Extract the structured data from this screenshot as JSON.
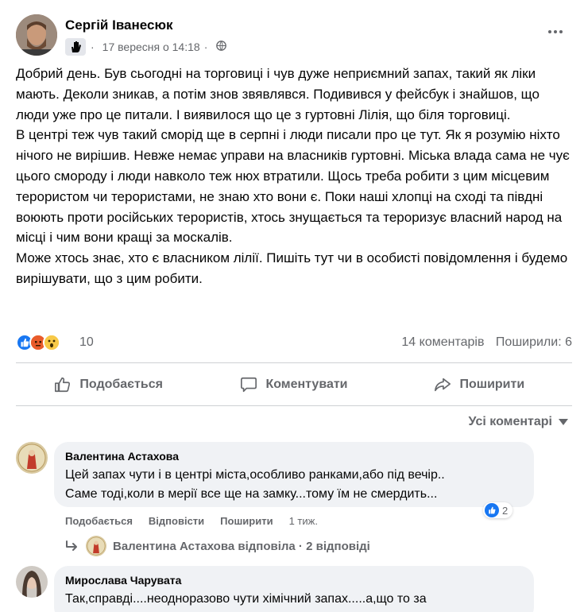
{
  "post": {
    "author": "Сергій Іванесюк",
    "date": "17 вересня о 14:18",
    "separator": "·",
    "paragraphs": [
      "Добрий день. Був сьогодні на торговиці і чув дуже неприємний запах, такий як ліки мають. Деколи зникав, а потім знов звявлявся. Подивився у фейсбук і знайшов, що люди уже про це питали. І виявилося що це з гуртовні Лілія, що біля торговиці.",
      "В центрі теж чув такий сморід ще в серпні і люди писали про це тут. Як я розумію ніхто нічого не вирішив. Невже немає управи на власників гуртовні. Міська влада сама не чує цього смороду і люди навколо теж нюх втратили. Щось треба робити з цим місцевим терористом чи терористами, не знаю хто вони є. Поки наші хлопці на сході та півдні воюють проти російських терористів, хтось знущається та тероризує власний народ на місці і чим вони кращі за москалів.",
      "Може хтось знає, хто є власником лілії. Пишіть тут чи в особисті повідомлення і будемо вирішувати, що з цим робити."
    ],
    "reactions_count": "10",
    "comments_count": "14 коментарів",
    "shares_count": "Поширили: 6"
  },
  "actions": {
    "like": "Подобається",
    "comment": "Коментувати",
    "share": "Поширити"
  },
  "sort_label": "Усі коментарі",
  "comments": [
    {
      "name": "Валентина Астахова",
      "text_line1": "Цей запах чути і в центрі міста,особливо ранками,або під вечір..",
      "text_line2": "Саме тоді,коли в мерії все ще на замку...тому їм не смердить...",
      "like": "Подобається",
      "reply": "Відповісти",
      "share": "Поширити",
      "time": "1 тиж.",
      "reaction_count": "2",
      "replies_summary": "Валентина Астахова відповіла · 2 відповіді"
    },
    {
      "name": "Мирослава Чарувата",
      "text_line1": "Так,справді....неодноразово чути хімічний запах.....а,що то за"
    }
  ],
  "colors": {
    "secondary_text": "#65676b",
    "bubble": "#f0f2f5",
    "like_blue": "#1877f2"
  }
}
